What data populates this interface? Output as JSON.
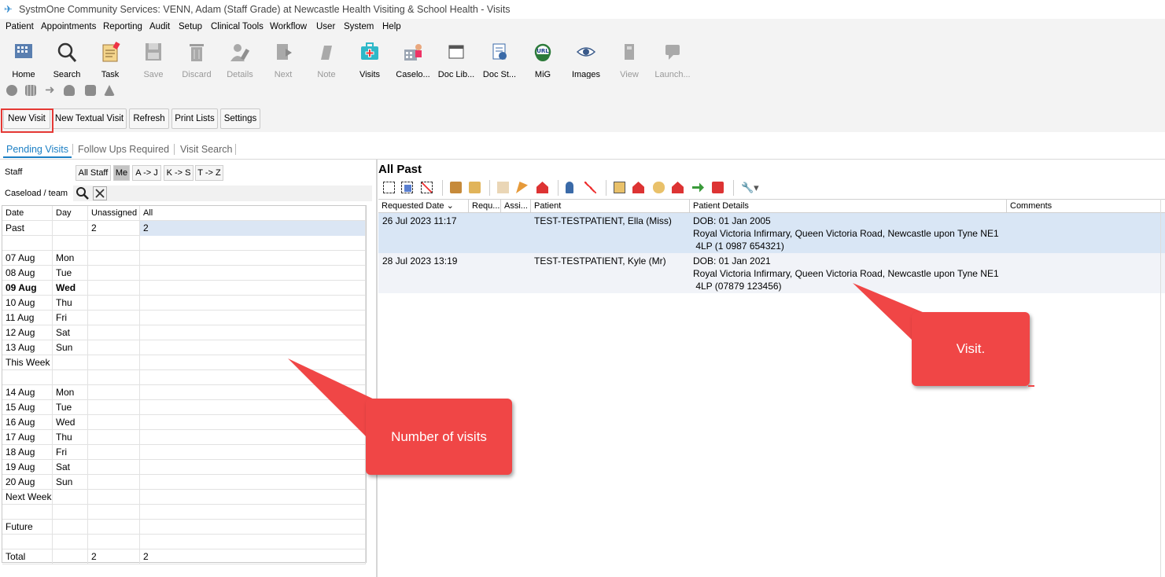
{
  "window": {
    "title": "SystmOne Community Services: VENN, Adam (Staff Grade) at Newcastle Health Visiting & School Health - Visits"
  },
  "menu": [
    "Patient",
    "Appointments",
    "Reporting",
    "Audit",
    "Setup",
    "Clinical Tools",
    "Workflow",
    "User",
    "System",
    "Help"
  ],
  "toolbar": [
    {
      "label": "Home",
      "icon": "home-icon",
      "enabled": true
    },
    {
      "label": "Search",
      "icon": "search-icon",
      "enabled": true
    },
    {
      "label": "Task",
      "icon": "task-icon",
      "enabled": true
    },
    {
      "label": "Save",
      "icon": "save-icon",
      "enabled": false
    },
    {
      "label": "Discard",
      "icon": "trash-icon",
      "enabled": false
    },
    {
      "label": "Details",
      "icon": "details-icon",
      "enabled": false
    },
    {
      "label": "Next",
      "icon": "next-icon",
      "enabled": false
    },
    {
      "label": "Note",
      "icon": "note-icon",
      "enabled": false
    },
    {
      "label": "Visits",
      "icon": "visits-icon",
      "enabled": true
    },
    {
      "label": "Caselo...",
      "icon": "caseload-icon",
      "enabled": true
    },
    {
      "label": "Doc Lib...",
      "icon": "doc-library-icon",
      "enabled": true
    },
    {
      "label": "Doc St...",
      "icon": "doc-store-icon",
      "enabled": true
    },
    {
      "label": "MiG",
      "icon": "mig-icon",
      "enabled": true
    },
    {
      "label": "Images",
      "icon": "eye-icon",
      "enabled": true
    },
    {
      "label": "View",
      "icon": "view-icon",
      "enabled": false
    },
    {
      "label": "Launch...",
      "icon": "launch-icon",
      "enabled": false
    }
  ],
  "actions": {
    "new_visit": "New Visit",
    "new_textual_visit": "New Textual Visit",
    "refresh": "Refresh",
    "print_lists": "Print Lists",
    "settings": "Settings"
  },
  "tabs": [
    "Pending Visits",
    "Follow Ups Required",
    "Visit Search"
  ],
  "filters": {
    "staff_label": "Staff",
    "caseload_label": "Caseload / team",
    "buttons": [
      "All Staff",
      "Me",
      "A -> J",
      "K -> S",
      "T -> Z"
    ]
  },
  "grid": {
    "headers": [
      "Date",
      "Day",
      "Unassigned",
      "All"
    ],
    "rows": [
      [
        "Past",
        "",
        "2",
        "2"
      ],
      [
        "",
        "",
        "",
        ""
      ],
      [
        "07 Aug",
        "Mon",
        "",
        ""
      ],
      [
        "08 Aug",
        "Tue",
        "",
        ""
      ],
      [
        "09 Aug",
        "Wed",
        "",
        ""
      ],
      [
        "10 Aug",
        "Thu",
        "",
        ""
      ],
      [
        "11 Aug",
        "Fri",
        "",
        ""
      ],
      [
        "12 Aug",
        "Sat",
        "",
        ""
      ],
      [
        "13 Aug",
        "Sun",
        "",
        ""
      ],
      [
        "This Week",
        "",
        "",
        ""
      ],
      [
        "",
        "",
        "",
        ""
      ],
      [
        "14 Aug",
        "Mon",
        "",
        ""
      ],
      [
        "15 Aug",
        "Tue",
        "",
        ""
      ],
      [
        "16 Aug",
        "Wed",
        "",
        ""
      ],
      [
        "17 Aug",
        "Thu",
        "",
        ""
      ],
      [
        "18 Aug",
        "Fri",
        "",
        ""
      ],
      [
        "19 Aug",
        "Sat",
        "",
        ""
      ],
      [
        "20 Aug",
        "Sun",
        "",
        ""
      ],
      [
        "Next Week",
        "",
        "",
        ""
      ],
      [
        "",
        "",
        "",
        ""
      ],
      [
        "Future",
        "",
        "",
        ""
      ],
      [
        "",
        "",
        "",
        ""
      ],
      [
        "Total",
        "",
        "2",
        "2"
      ]
    ]
  },
  "right": {
    "title": "All Past",
    "headers": [
      "Requested Date",
      "Requ...",
      "Assi...",
      "Patient",
      "Patient Details",
      "Comments"
    ],
    "visits": [
      {
        "date": "26 Jul 2023 11:17",
        "patient": "TEST-TESTPATIENT, Ella (Miss)",
        "details": [
          "DOB: 01 Jan 2005",
          "Royal Victoria Infirmary, Queen Victoria Road, Newcastle upon Tyne NE1",
          " 4LP (1 0987 654321)"
        ]
      },
      {
        "date": "28 Jul 2023 13:19",
        "patient": "TEST-TESTPATIENT, Kyle (Mr)",
        "details": [
          "DOB: 01 Jan 2021",
          "Royal Victoria Infirmary, Queen Victoria Road, Newcastle upon Tyne NE1",
          " 4LP (07879 123456)"
        ]
      }
    ]
  },
  "annotations": {
    "visit": "Visit.",
    "number_of_visits": "Number of visits"
  },
  "colors": {
    "selected_row": "#d9e6f5",
    "alt_row": "#f1f3f8",
    "callout": "#f04646",
    "tab_active": "#1b7fc4"
  }
}
